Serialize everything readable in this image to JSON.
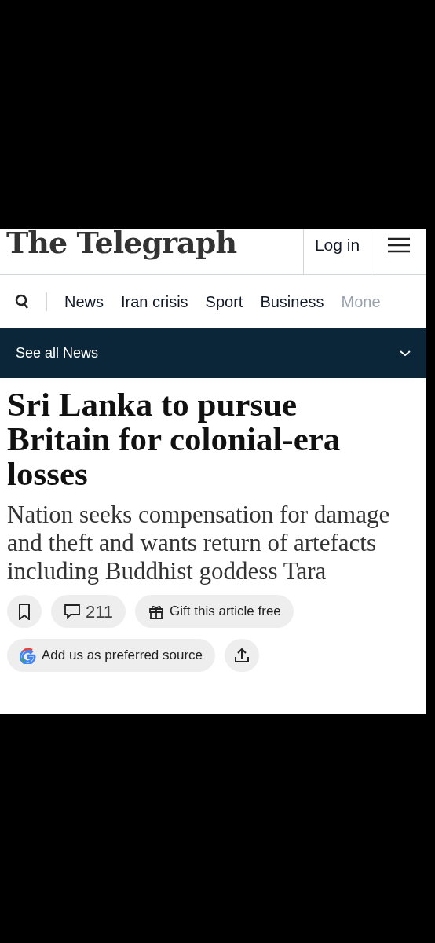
{
  "masthead": {
    "logo": "The Telegraph",
    "login": "Log in"
  },
  "nav": {
    "items": [
      {
        "label": "News",
        "faded": false
      },
      {
        "label": "Iran crisis",
        "faded": false
      },
      {
        "label": "Sport",
        "faded": false
      },
      {
        "label": "Business",
        "faded": false
      },
      {
        "label": "Mone",
        "faded": true
      }
    ]
  },
  "section_bar": {
    "label": "See all News"
  },
  "article": {
    "headline": "Sri Lanka to pursue Britain for colonial-era losses",
    "standfirst": "Nation seeks compensation for damage and theft and wants return of artefacts including Buddhist goddess Tara"
  },
  "actions": [
    {
      "kind": "bookmark"
    },
    {
      "kind": "comments",
      "label": "211"
    },
    {
      "kind": "gift",
      "label": "Gift this article free"
    },
    {
      "kind": "google",
      "label": "Add us as preferred source"
    },
    {
      "kind": "share"
    }
  ]
}
